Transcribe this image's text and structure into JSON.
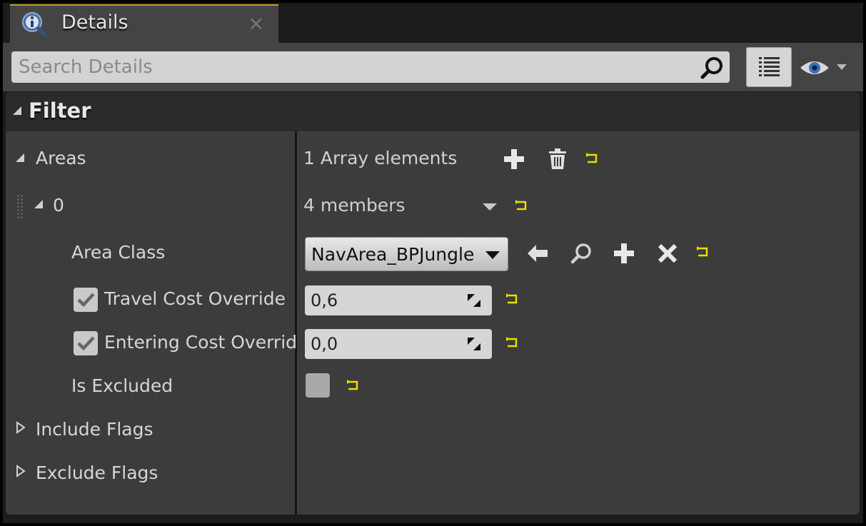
{
  "tab": {
    "title": "Details",
    "close": "×"
  },
  "search": {
    "placeholder": "Search Details",
    "value": ""
  },
  "filter": {
    "title": "Filter"
  },
  "rows": {
    "areas": {
      "label": "Areas",
      "value": "1 Array elements"
    },
    "element0": {
      "label": "0",
      "value": "4 members"
    },
    "area_class": {
      "label": "Area Class",
      "value": "NavArea_BPJungle"
    },
    "travel_cost": {
      "label": "Travel Cost Override",
      "value": "0,6",
      "checked": true
    },
    "entering_cost": {
      "label": "Entering Cost Overrid",
      "value": "0,0",
      "checked": true
    },
    "is_excluded": {
      "label": "Is Excluded",
      "checked": false
    },
    "include_flags": {
      "label": "Include Flags"
    },
    "exclude_flags": {
      "label": "Exclude Flags"
    }
  },
  "icons": {
    "tab": "details-info-icon",
    "search": "search-icon",
    "view_options": "list-view-icon",
    "visibility": "eye-icon",
    "add": "plus-icon",
    "delete": "trash-icon",
    "reset": "reset-to-default-icon",
    "use_selected": "left-arrow-icon",
    "browse": "magnifier-icon",
    "clear": "x-icon"
  },
  "colors": {
    "accent_tab": "#c8a021",
    "reset_icon": "#e7e000",
    "panel_bg": "#3c3c3c",
    "header_bg": "#2b2b2b"
  }
}
